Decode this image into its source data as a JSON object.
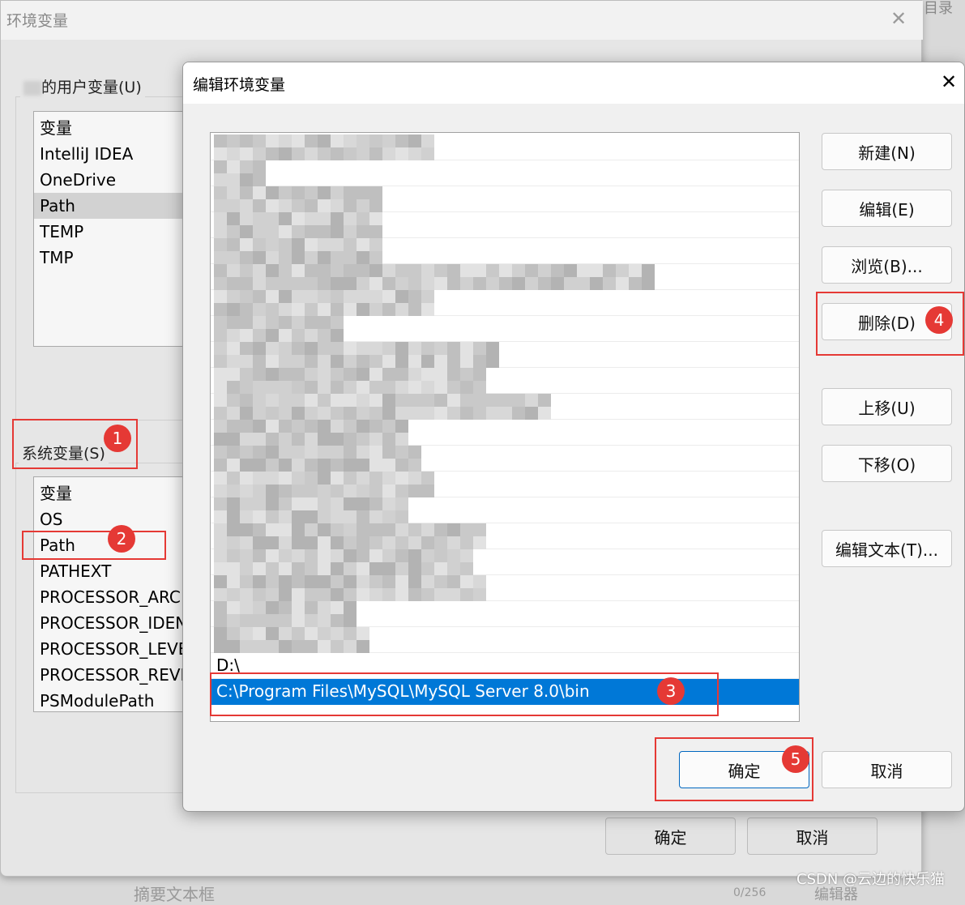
{
  "background_window": {
    "title": "环境变量",
    "user_vars_label": "的用户变量(U)",
    "user_vars": [
      "变量",
      "IntelliJ IDEA",
      "OneDrive",
      "Path",
      "TEMP",
      "TMP"
    ],
    "system_vars_label": "系统变量(S)",
    "system_vars": [
      "变量",
      "OS",
      "Path",
      "PATHEXT",
      "PROCESSOR_ARC",
      "PROCESSOR_IDEN",
      "PROCESSOR_LEVE",
      "PROCESSOR_REVI",
      "PSModulePath"
    ],
    "ok_label": "确定",
    "cancel_label": "取消"
  },
  "behind": {
    "toc_label": "目录",
    "summary_label": "摘要文本框",
    "counter": "0/256",
    "editor_label": "编辑器"
  },
  "dialog": {
    "title": "编辑环境变量",
    "partial_entry": "D:\\",
    "selected_entry": "C:\\Program Files\\MySQL\\MySQL Server 8.0\\bin",
    "buttons": {
      "new": "新建(N)",
      "edit": "编辑(E)",
      "browse": "浏览(B)...",
      "delete": "删除(D)",
      "move_up": "上移(U)",
      "move_down": "下移(O)",
      "edit_text": "编辑文本(T)...",
      "ok": "确定",
      "cancel": "取消"
    }
  },
  "annotations": [
    "1",
    "2",
    "3",
    "4",
    "5"
  ],
  "watermark": "CSDN @云边的快乐猫",
  "colors": {
    "selection": "#0078d7",
    "annotation": "#e53935"
  }
}
